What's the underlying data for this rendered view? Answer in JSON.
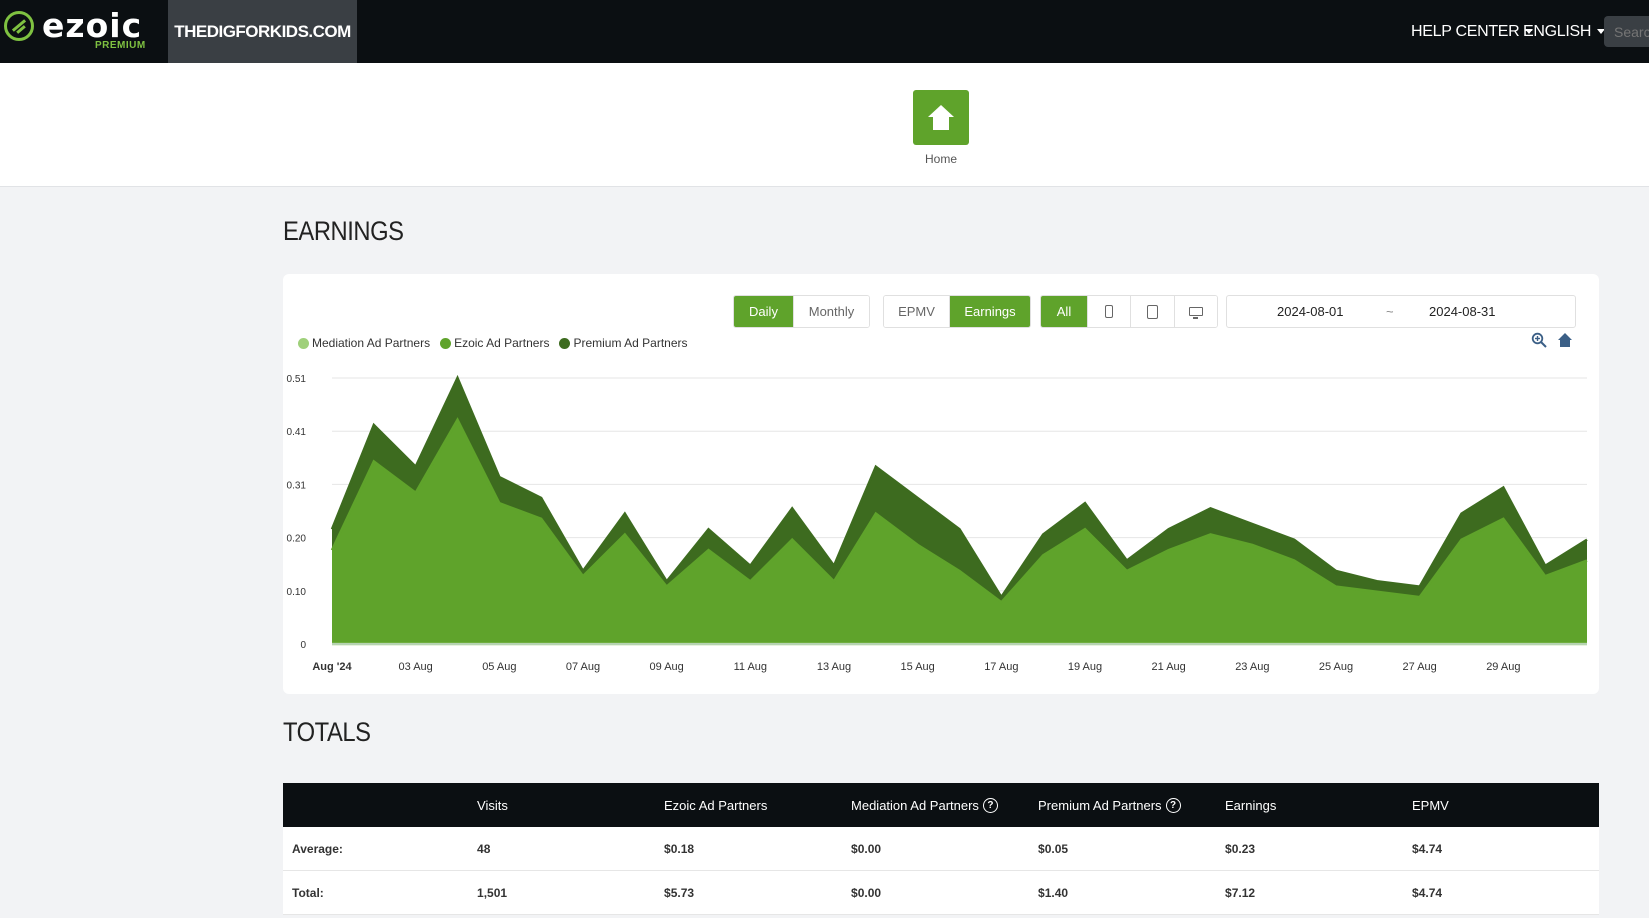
{
  "topbar": {
    "logo_text": "ezoic",
    "logo_sub": "PREMIUM",
    "site_name": "THEDIGFORKIDS.COM",
    "help_center": "HELP CENTER",
    "language": "ENGLISH",
    "search_placeholder": "Search"
  },
  "home": {
    "label": "Home"
  },
  "earnings": {
    "title": "EARNINGS",
    "period_buttons": [
      {
        "label": "Daily",
        "active": true
      },
      {
        "label": "Monthly",
        "active": false
      }
    ],
    "metric_buttons": [
      {
        "label": "EPMV",
        "active": false
      },
      {
        "label": "Earnings",
        "active": true
      }
    ],
    "device_buttons": [
      {
        "label": "All",
        "active": true
      },
      {
        "icon": "mobile-icon"
      },
      {
        "icon": "tablet-icon"
      },
      {
        "icon": "desktop-icon"
      }
    ],
    "date_start": "2024-08-01",
    "date_sep": "~",
    "date_end": "2024-08-31",
    "colors": {
      "accent": "#5fa32b",
      "ezoic": "#5fa32b",
      "premium": "#3d6b1f",
      "mediation": "#9fd07a"
    }
  },
  "chart_data": {
    "type": "area",
    "stacked": true,
    "legend_position": "top-left",
    "ylim": [
      0,
      0.51
    ],
    "y_ticks": [
      "0",
      "0.10",
      "0.20",
      "0.31",
      "0.41",
      "0.51"
    ],
    "x": [
      "2024-08-01",
      "2024-08-02",
      "2024-08-03",
      "2024-08-04",
      "2024-08-05",
      "2024-08-06",
      "2024-08-07",
      "2024-08-08",
      "2024-08-09",
      "2024-08-10",
      "2024-08-11",
      "2024-08-12",
      "2024-08-13",
      "2024-08-14",
      "2024-08-15",
      "2024-08-16",
      "2024-08-17",
      "2024-08-18",
      "2024-08-19",
      "2024-08-20",
      "2024-08-21",
      "2024-08-22",
      "2024-08-23",
      "2024-08-24",
      "2024-08-25",
      "2024-08-26",
      "2024-08-27",
      "2024-08-28",
      "2024-08-29",
      "2024-08-30",
      "2024-08-31"
    ],
    "x_tick_labels": [
      "Aug '24",
      "03 Aug",
      "05 Aug",
      "07 Aug",
      "09 Aug",
      "11 Aug",
      "13 Aug",
      "15 Aug",
      "17 Aug",
      "19 Aug",
      "21 Aug",
      "23 Aug",
      "25 Aug",
      "27 Aug",
      "29 Aug"
    ],
    "series": [
      {
        "name": "Mediation Ad Partners",
        "color": "#9fd07a",
        "values": [
          0,
          0,
          0,
          0,
          0,
          0,
          0,
          0,
          0,
          0,
          0,
          0,
          0,
          0,
          0,
          0,
          0,
          0,
          0,
          0,
          0,
          0,
          0,
          0,
          0,
          0,
          0,
          0,
          0,
          0,
          0
        ]
      },
      {
        "name": "Ezoic Ad Partners",
        "color": "#5fa32b",
        "values": [
          0.18,
          0.35,
          0.29,
          0.43,
          0.27,
          0.24,
          0.13,
          0.21,
          0.11,
          0.18,
          0.12,
          0.2,
          0.12,
          0.25,
          0.19,
          0.14,
          0.08,
          0.17,
          0.22,
          0.14,
          0.18,
          0.21,
          0.19,
          0.16,
          0.11,
          0.1,
          0.09,
          0.2,
          0.24,
          0.13,
          0.16
        ]
      },
      {
        "name": "Premium Ad Partners",
        "color": "#3d6b1f",
        "values": [
          0.04,
          0.07,
          0.05,
          0.08,
          0.05,
          0.04,
          0.01,
          0.04,
          0.01,
          0.04,
          0.03,
          0.06,
          0.03,
          0.09,
          0.09,
          0.08,
          0.01,
          0.04,
          0.05,
          0.02,
          0.04,
          0.05,
          0.04,
          0.04,
          0.03,
          0.02,
          0.02,
          0.05,
          0.06,
          0.02,
          0.04
        ]
      }
    ]
  },
  "totals": {
    "title": "TOTALS",
    "columns": [
      "",
      "Visits",
      "Ezoic Ad Partners",
      "Mediation Ad Partners",
      "Premium Ad Partners",
      "Earnings",
      "EPMV"
    ],
    "rows": [
      [
        "Average:",
        "48",
        "$0.18",
        "$0.00",
        "$0.05",
        "$0.23",
        "$4.74"
      ],
      [
        "Total:",
        "1,501",
        "$5.73",
        "$0.00",
        "$1.40",
        "$7.12",
        "$4.74"
      ]
    ]
  }
}
